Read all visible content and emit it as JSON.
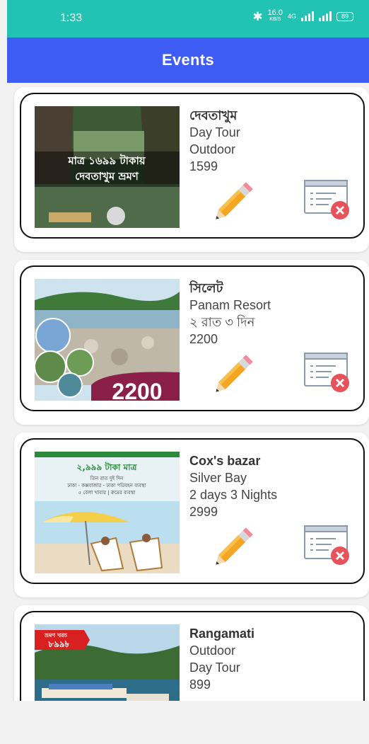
{
  "status_bar": {
    "time": "1:33",
    "net_speed_value": "16.0",
    "net_speed_unit": "KB/S",
    "network_type": "4G",
    "battery": "89"
  },
  "app_bar": {
    "title": "Events"
  },
  "events": [
    {
      "title": "দেবতাখুম",
      "line1": "Day Tour",
      "line2": "Outdoor",
      "price": "1599",
      "image_text": [
        "মাত্র ১৬৯৯ টাকায়",
        "দেবতাখুম ভ্রমণ"
      ]
    },
    {
      "title": "সিলেট",
      "line1": "Panam Resort",
      "line2": "২ রাত ৩ দিন",
      "price": "2200",
      "image_text": [
        "2200"
      ]
    },
    {
      "title": "Cox's bazar",
      "line1": "Silver Bay",
      "line2": "2 days 3 Nights",
      "price": "2999",
      "image_text": [
        "২,৯৯৯ টাকা মাত্র",
        "তিন রাত দুই দিন",
        "ঢাকা - কক্সবাজার - ঢাকা পরিবহন ব্যবস্থা",
        "৫ বেলা খাবার | রুমের ব্যবস্থা"
      ]
    },
    {
      "title": "Rangamati",
      "line1": "Outdoor",
      "line2": "Day Tour",
      "price": "899",
      "image_text": [
        "ভ্রমণ খরচ",
        "৮৯৯৳"
      ]
    }
  ],
  "icons": {
    "edit": "pencil-icon",
    "delete": "list-delete-icon"
  },
  "colors": {
    "status_bar": "#22c3b2",
    "app_bar": "#3f5cf5",
    "delete_badge": "#e8525a",
    "pencil": "#f5a524"
  }
}
